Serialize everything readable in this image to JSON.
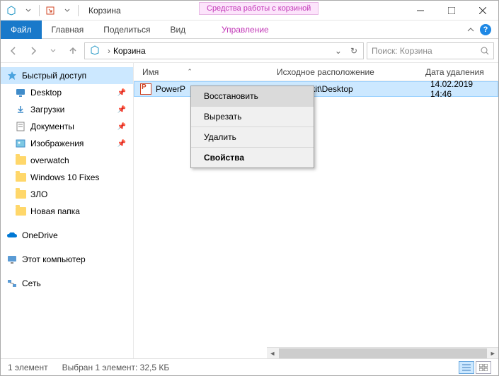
{
  "title": "Корзина",
  "contextual_tab": "Средства работы с корзиной",
  "ribbon": {
    "file": "Файл",
    "home": "Главная",
    "share": "Поделиться",
    "view": "Вид",
    "manage": "Управление"
  },
  "breadcrumb": {
    "location": "Корзина"
  },
  "search": {
    "placeholder": "Поиск: Корзина"
  },
  "sidebar": {
    "quick_access": "Быстрый доступ",
    "items": [
      {
        "label": "Desktop",
        "pinned": true
      },
      {
        "label": "Загрузки",
        "pinned": true
      },
      {
        "label": "Документы",
        "pinned": true
      },
      {
        "label": "Изображения",
        "pinned": true
      },
      {
        "label": "overwatch",
        "pinned": false
      },
      {
        "label": "Windows 10 Fixes",
        "pinned": false
      },
      {
        "label": "ЗЛО",
        "pinned": false
      },
      {
        "label": "Новая папка",
        "pinned": false
      }
    ],
    "onedrive": "OneDrive",
    "this_pc": "Этот компьютер",
    "network": "Сеть"
  },
  "columns": {
    "name": "Имя",
    "location": "Исходное расположение",
    "date": "Дата удаления"
  },
  "files": [
    {
      "name": "PowerP",
      "location": "Jsers\\nikit\\Desktop",
      "date": "14.02.2019 14:46"
    }
  ],
  "context_menu": {
    "restore": "Восстановить",
    "cut": "Вырезать",
    "delete": "Удалить",
    "properties": "Свойства"
  },
  "status": {
    "count": "1 элемент",
    "selection": "Выбран 1 элемент: 32,5 КБ"
  }
}
